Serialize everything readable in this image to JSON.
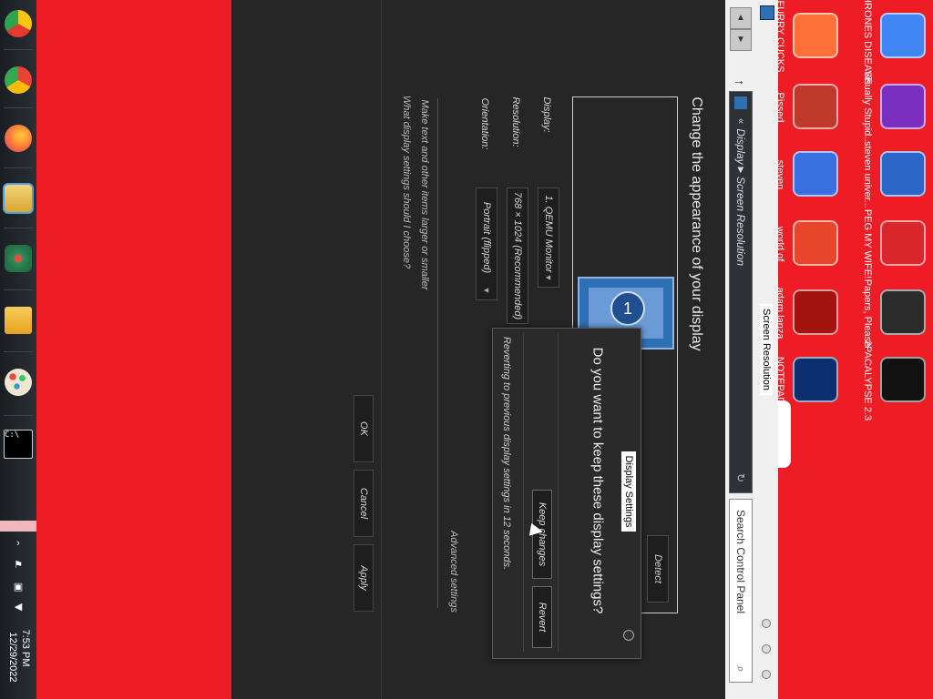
{
  "taskbar": {
    "apps": [
      {
        "name": "Chrome beta",
        "color": "#f5c518"
      },
      {
        "name": "Google Chrome",
        "color": "#4285f4"
      },
      {
        "name": "Firefox",
        "color": "#ff7139"
      },
      {
        "name": "File Explorer",
        "color": "#4aa3df"
      },
      {
        "name": "Pinball",
        "color": "#2e8b57"
      },
      {
        "name": "Folder",
        "color": "#f2b632"
      },
      {
        "name": "Paint",
        "color": "#7fb2e5"
      },
      {
        "name": "Command Prompt",
        "color": "#111111"
      }
    ],
    "clock": {
      "time": "7:53 PM",
      "date": "12/29/2022"
    }
  },
  "window": {
    "title": "Screen Resolution",
    "breadcrumb": [
      "Display",
      "Screen Resolution"
    ],
    "search_placeholder": "Search Control Panel",
    "heading": "Change the appearance of your display",
    "detect_label": "Detect",
    "monitor_number": "1",
    "fields": {
      "display_label": "Display:",
      "display_value": "1. QEMU Monitor",
      "resolution_label": "Resolution:",
      "resolution_value": "768 × 1024 (Recommended)",
      "orientation_label": "Orientation:",
      "orientation_value": "Portrait (flipped)"
    },
    "advanced_link": "Advanced settings",
    "links": [
      "Make text and other items larger or smaller",
      "What display settings should I choose?"
    ],
    "buttons": {
      "ok": "OK",
      "cancel": "Cancel",
      "apply": "Apply"
    }
  },
  "dialog": {
    "title": "Display Settings",
    "question": "Do you want to keep these display settings?",
    "keep_label": "Keep changes",
    "revert_label": "Revert",
    "info": "Reverting to previous display settings in 12 seconds."
  },
  "desktop": {
    "icons": [
      {
        "label": "CHRONES DISEASE",
        "color": "#4285f4"
      },
      {
        "label": "FURRY CUCKS",
        "color": "#ff7139"
      },
      {
        "label": "Visually Stupid...",
        "color": "#7b2fbf"
      },
      {
        "label": "Pissed",
        "color": "#c0392b"
      },
      {
        "label": "steven univer...",
        "color": "#2c67c8"
      },
      {
        "label": "steven",
        "color": "#3a6fe0"
      },
      {
        "label": "PEG MY WIFE!",
        "color": "#d9262b"
      },
      {
        "label": "world of",
        "color": "#e8462a"
      },
      {
        "label": "Papers, Please",
        "color": "#2b2b2b"
      },
      {
        "label": "adam lanza",
        "color": "#a3130f"
      },
      {
        "label": "2PACALYPSE 2.3",
        "color": "#111111"
      },
      {
        "label": "NOTEPAD",
        "color": "#0d2e6e"
      }
    ]
  }
}
